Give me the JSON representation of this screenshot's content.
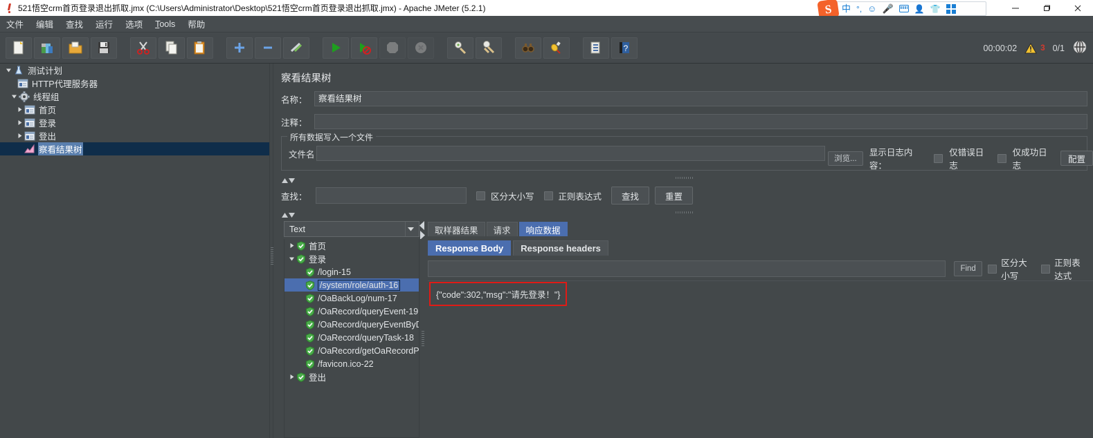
{
  "window": {
    "title": "521悟空crm首页登录退出抓取.jmx (C:\\Users\\Administrator\\Desktop\\521悟空crm首页登录退出抓取.jmx) - Apache JMeter (5.2.1)",
    "app_icon": "jmeter-icon",
    "minimize": "minimize-icon",
    "maximize": "maximize-icon",
    "close": "close-icon"
  },
  "ime": {
    "logo": "S",
    "items": [
      "中",
      "punctuation-icon",
      "emoji-icon",
      "microphone-icon",
      "keyboard-icon",
      "user-icon",
      "skin-icon",
      "apps-icon"
    ]
  },
  "menu": {
    "items": [
      {
        "label": "文件"
      },
      {
        "label": "编辑"
      },
      {
        "label": "查找"
      },
      {
        "label": "运行"
      },
      {
        "label": "选项"
      },
      {
        "label": "Tools",
        "mnemonic": "T"
      },
      {
        "label": "帮助"
      }
    ]
  },
  "toolbar": {
    "buttons": [
      {
        "name": "new-icon"
      },
      {
        "name": "templates-icon"
      },
      {
        "name": "open-icon"
      },
      {
        "name": "save-icon"
      },
      {
        "name": "cut-icon"
      },
      {
        "name": "copy-icon"
      },
      {
        "name": "paste-icon"
      },
      {
        "name": "expand-icon"
      },
      {
        "name": "collapse-icon"
      },
      {
        "name": "toggle-icon"
      },
      {
        "name": "start-icon"
      },
      {
        "name": "start-no-pauses-icon"
      },
      {
        "name": "stop-icon"
      },
      {
        "name": "shutdown-icon"
      },
      {
        "name": "clear-icon"
      },
      {
        "name": "clear-all-icon"
      },
      {
        "name": "search-icon"
      },
      {
        "name": "search-reset-icon"
      },
      {
        "name": "function-helper-icon"
      },
      {
        "name": "help-icon"
      }
    ],
    "timer": "00:00:02",
    "warnings": "3",
    "threads": "0/1",
    "remote_icon": "remote-engines-icon"
  },
  "test_plan_tree": {
    "nodes": [
      {
        "label": "测试计划",
        "icon": "test-plan-icon",
        "depth": 0,
        "toggle": "expanded",
        "selected": false
      },
      {
        "label": "HTTP代理服务器",
        "icon": "http-proxy-icon",
        "depth": 1,
        "toggle": "none",
        "selected": false
      },
      {
        "label": "线程组",
        "icon": "thread-group-icon",
        "depth": 1,
        "toggle": "expanded",
        "selected": false
      },
      {
        "label": "首页",
        "icon": "http-sampler-icon",
        "depth": 2,
        "toggle": "collapsed",
        "selected": false
      },
      {
        "label": "登录",
        "icon": "http-sampler-icon",
        "depth": 2,
        "toggle": "collapsed",
        "selected": false
      },
      {
        "label": "登出",
        "icon": "http-sampler-icon",
        "depth": 2,
        "toggle": "collapsed",
        "selected": false
      },
      {
        "label": "察看结果树",
        "icon": "view-results-tree-icon",
        "depth": 2,
        "toggle": "none",
        "selected": true
      }
    ]
  },
  "panel": {
    "title": "察看结果树",
    "name_label": "名称：",
    "name_value": "察看结果树",
    "comment_label": "注释：",
    "comment_value": "",
    "file_group_title": "所有数据写入一个文件",
    "filename_label": "文件名",
    "filename_value": "",
    "browse_button": "浏览...",
    "log_display_label": "显示日志内容：",
    "errors_only": "仅错误日志",
    "successes_only": "仅成功日志",
    "configure_button": "配置",
    "search_label": "查找：",
    "search_value": "",
    "case_sensitive": "区分大小写",
    "regexp": "正则表达式",
    "search_button": "查找",
    "reset_button": "重置"
  },
  "results": {
    "renderer_selected": "Text",
    "items": [
      {
        "label": "首页",
        "toggle": "collapsed",
        "depth": 0,
        "selected": false,
        "boxed": false
      },
      {
        "label": "登录",
        "toggle": "expanded",
        "depth": 0,
        "selected": false,
        "boxed": false
      },
      {
        "label": "/login-15",
        "toggle": "none",
        "depth": 1,
        "selected": false,
        "boxed": false
      },
      {
        "label": "/system/role/auth-16",
        "toggle": "none",
        "depth": 1,
        "selected": true,
        "boxed": true
      },
      {
        "label": "/OaBackLog/num-17",
        "toggle": "none",
        "depth": 1,
        "selected": false,
        "boxed": false
      },
      {
        "label": "/OaRecord/queryEvent-19",
        "toggle": "none",
        "depth": 1,
        "selected": false,
        "boxed": false
      },
      {
        "label": "/OaRecord/queryEventByDa",
        "toggle": "none",
        "depth": 1,
        "selected": false,
        "boxed": false
      },
      {
        "label": "/OaRecord/queryTask-18",
        "toggle": "none",
        "depth": 1,
        "selected": false,
        "boxed": false
      },
      {
        "label": "/OaRecord/getOaRecordPa",
        "toggle": "none",
        "depth": 1,
        "selected": false,
        "boxed": false
      },
      {
        "label": "/favicon.ico-22",
        "toggle": "none",
        "depth": 1,
        "selected": false,
        "boxed": false
      },
      {
        "label": "登出",
        "toggle": "collapsed",
        "depth": 0,
        "selected": false,
        "boxed": false
      }
    ]
  },
  "detail": {
    "tabs": [
      {
        "label": "取样器结果",
        "active": false
      },
      {
        "label": "请求",
        "active": false
      },
      {
        "label": "响应数据",
        "active": true
      }
    ],
    "sub_tabs": [
      {
        "label": "Response Body",
        "active": true
      },
      {
        "label": "Response headers",
        "active": false
      }
    ],
    "find_value": "",
    "find_button": "Find",
    "case_sensitive": "区分大小写",
    "regexp": "正则表达式",
    "response_body": "{\"code\":302,\"msg\":\"请先登录！\"}"
  },
  "colors": {
    "background": "#43484a",
    "selection_blue": "#4b6eaf",
    "tree_selection": "#0f2d4a",
    "highlight_red": "#e01b16",
    "warning_red": "#d33a2e",
    "titlebar": "#ffffff"
  }
}
